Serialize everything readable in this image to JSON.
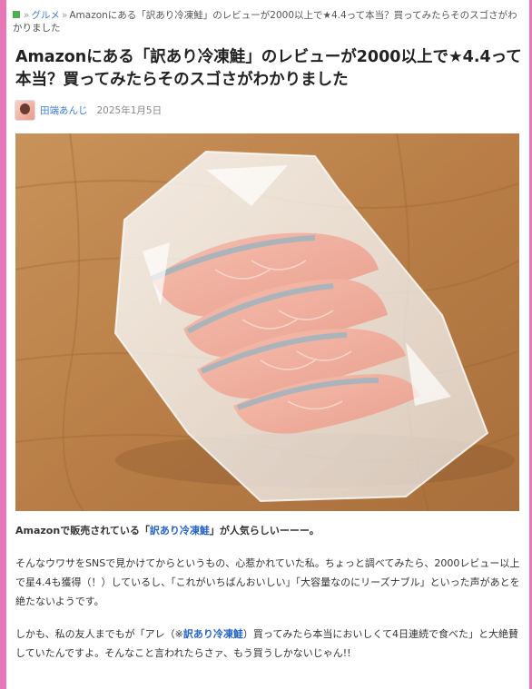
{
  "breadcrumb": {
    "gourmet": "グルメ",
    "current": "Amazonにある「訳あり冷凍鮭」のレビューが2000以上で★4.4って本当？買ってみたらそのスゴさがわかりました"
  },
  "article": {
    "title": "Amazonにある「訳あり冷凍鮭」のレビューが2000以上で★4.4って本当？買ってみたらそのスゴさがわかりました",
    "author": "田端あんじ",
    "date": "2025年1月5日"
  },
  "body": {
    "p1_a": "Amazonで販売されている「",
    "p1_link": "訳あり冷凍鮭",
    "p1_b": "」が人気らしいーーー。",
    "p2": "そんなウワサをSNSで見かけてからというもの、心惹かれていた私。ちょっと調べてみたら、2000レビュー以上で星4.4も獲得（！）しているし、「これがいちばんおいしい」「大容量なのにリーズナブル」といった声があとを絶たないようです。",
    "p3_a": "しかも、私の友人までもが「アレ（※",
    "p3_link": "訳あり冷凍鮭",
    "p3_b": "）買ってみたら本当においしくて4日連続で食べた」と大絶賛していたんですよ。そんなこと言われたらさァ、もう買うしかないじゃん!!"
  },
  "colors": {
    "frame": "#e678b8",
    "link": "#2563c9",
    "breadcrumb_icon": "#4caf50"
  }
}
